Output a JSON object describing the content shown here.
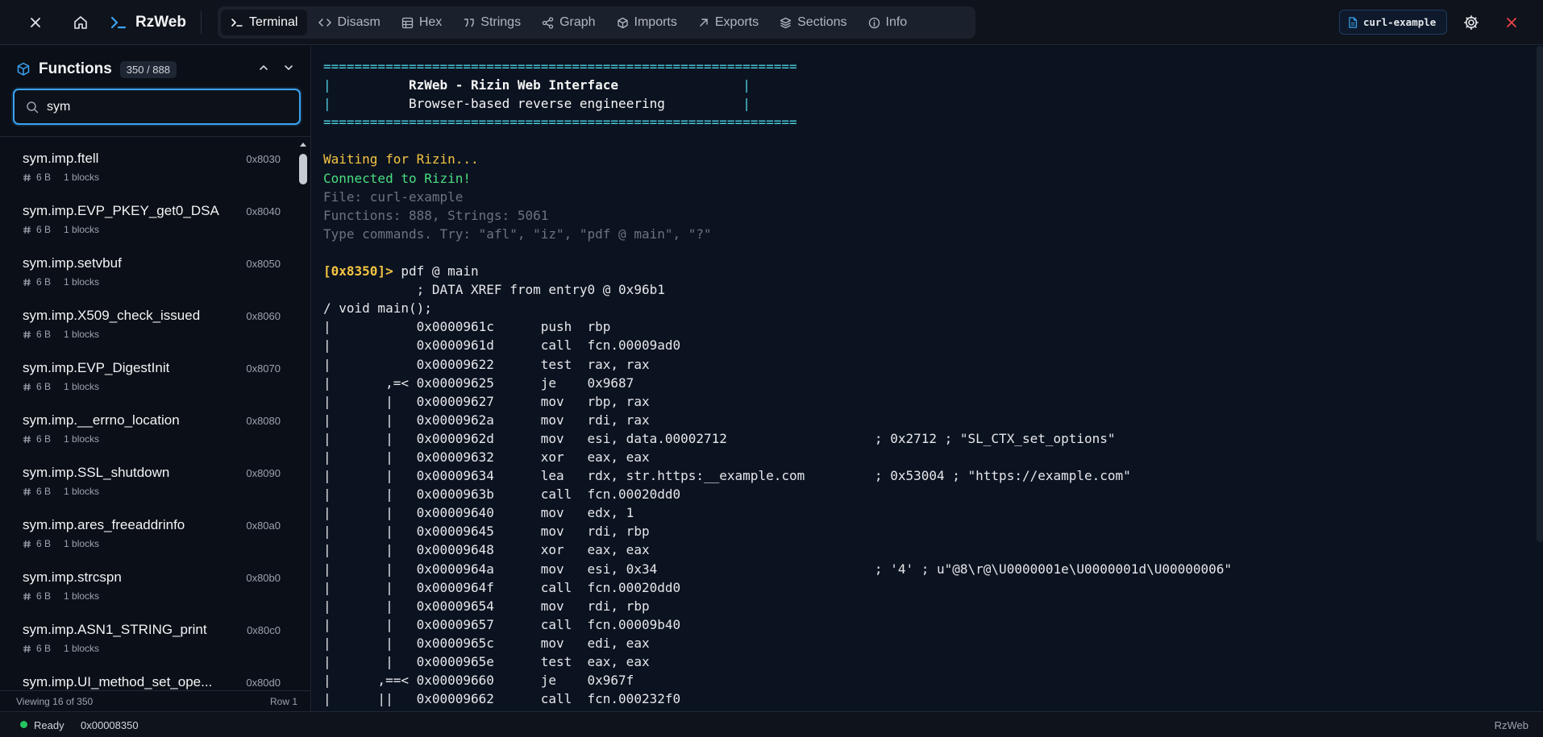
{
  "app": {
    "name": "RzWeb"
  },
  "tabs": [
    {
      "label": "Terminal",
      "icon": "terminal-icon",
      "active": true
    },
    {
      "label": "Disasm",
      "icon": "code-icon"
    },
    {
      "label": "Hex",
      "icon": "grid-icon"
    },
    {
      "label": "Strings",
      "icon": "quote-icon"
    },
    {
      "label": "Graph",
      "icon": "share-icon"
    },
    {
      "label": "Imports",
      "icon": "package-icon"
    },
    {
      "label": "Exports",
      "icon": "arrow-up-right-icon"
    },
    {
      "label": "Sections",
      "icon": "layers-icon"
    },
    {
      "label": "Info",
      "icon": "info-icon"
    }
  ],
  "file_chip": {
    "label": "curl-example"
  },
  "sidebar": {
    "title": "Functions",
    "count": "350 / 888",
    "search_value": "sym",
    "footer_left": "Viewing 16 of 350",
    "footer_right": "Row 1",
    "functions": [
      {
        "name": "sym.imp.ftell",
        "addr": "0x8030",
        "size": "6 B",
        "blocks": "1 blocks"
      },
      {
        "name": "sym.imp.EVP_PKEY_get0_DSA",
        "addr": "0x8040",
        "size": "6 B",
        "blocks": "1 blocks"
      },
      {
        "name": "sym.imp.setvbuf",
        "addr": "0x8050",
        "size": "6 B",
        "blocks": "1 blocks"
      },
      {
        "name": "sym.imp.X509_check_issued",
        "addr": "0x8060",
        "size": "6 B",
        "blocks": "1 blocks"
      },
      {
        "name": "sym.imp.EVP_DigestInit",
        "addr": "0x8070",
        "size": "6 B",
        "blocks": "1 blocks"
      },
      {
        "name": "sym.imp.__errno_location",
        "addr": "0x8080",
        "size": "6 B",
        "blocks": "1 blocks"
      },
      {
        "name": "sym.imp.SSL_shutdown",
        "addr": "0x8090",
        "size": "6 B",
        "blocks": "1 blocks"
      },
      {
        "name": "sym.imp.ares_freeaddrinfo",
        "addr": "0x80a0",
        "size": "6 B",
        "blocks": "1 blocks"
      },
      {
        "name": "sym.imp.strcspn",
        "addr": "0x80b0",
        "size": "6 B",
        "blocks": "1 blocks"
      },
      {
        "name": "sym.imp.ASN1_STRING_print",
        "addr": "0x80c0",
        "size": "6 B",
        "blocks": "1 blocks"
      },
      {
        "name": "sym.imp.UI_method_set_ope...",
        "addr": "0x80d0",
        "size": "6 B",
        "blocks": "1 blocks"
      }
    ]
  },
  "terminal": {
    "lines": [
      {
        "segments": [
          {
            "t": "=============================================================",
            "c": "c-cyan"
          }
        ]
      },
      {
        "segments": [
          {
            "t": "|",
            "c": "c-cyan"
          },
          {
            "t": "          RzWeb - Rizin Web Interface                ",
            "c": "c-white c-bold"
          },
          {
            "t": "|",
            "c": "c-cyan"
          }
        ]
      },
      {
        "segments": [
          {
            "t": "|",
            "c": "c-cyan"
          },
          {
            "t": "          Browser-based reverse engineering          ",
            "c": "c-white"
          },
          {
            "t": "|",
            "c": "c-cyan"
          }
        ]
      },
      {
        "segments": [
          {
            "t": "=============================================================",
            "c": "c-cyan"
          }
        ]
      },
      {
        "segments": [
          {
            "t": ""
          }
        ]
      },
      {
        "segments": [
          {
            "t": "Waiting for Rizin...",
            "c": "c-yellow"
          }
        ]
      },
      {
        "segments": [
          {
            "t": "Connected to Rizin!",
            "c": "c-green"
          }
        ]
      },
      {
        "segments": [
          {
            "t": "File: curl-example",
            "c": "c-gray"
          }
        ]
      },
      {
        "segments": [
          {
            "t": "Functions: 888, Strings: 5061",
            "c": "c-gray"
          }
        ]
      },
      {
        "segments": [
          {
            "t": "Type commands. Try: \"afl\", \"iz\", \"pdf @ main\", \"?\"",
            "c": "c-gray"
          }
        ]
      },
      {
        "segments": [
          {
            "t": ""
          }
        ]
      },
      {
        "segments": [
          {
            "t": "[0x8350]>",
            "c": "c-yellow c-bold"
          },
          {
            "t": " pdf @ main"
          }
        ]
      },
      {
        "segments": [
          {
            "t": "            ; DATA XREF from entry0 @ 0x96b1"
          }
        ]
      },
      {
        "segments": [
          {
            "t": "/ void main();"
          }
        ]
      },
      {
        "segments": [
          {
            "t": "|           0x0000961c      push  rbp"
          }
        ]
      },
      {
        "segments": [
          {
            "t": "|           0x0000961d      call  fcn.00009ad0"
          }
        ]
      },
      {
        "segments": [
          {
            "t": "|           0x00009622      test  rax, rax"
          }
        ]
      },
      {
        "segments": [
          {
            "t": "|       ,=< 0x00009625      je    0x9687"
          }
        ]
      },
      {
        "segments": [
          {
            "t": "|       |   0x00009627      mov   rbp, rax"
          }
        ]
      },
      {
        "segments": [
          {
            "t": "|       |   0x0000962a      mov   rdi, rax"
          }
        ]
      },
      {
        "segments": [
          {
            "t": "|       |   0x0000962d      mov   esi, data.00002712                   ; 0x2712 ; \"SL_CTX_set_options\""
          }
        ]
      },
      {
        "segments": [
          {
            "t": "|       |   0x00009632      xor   eax, eax"
          }
        ]
      },
      {
        "segments": [
          {
            "t": "|       |   0x00009634      lea   rdx, str.https:__example.com         ; 0x53004 ; \"https://example.com\""
          }
        ]
      },
      {
        "segments": [
          {
            "t": "|       |   0x0000963b      call  fcn.00020dd0"
          }
        ]
      },
      {
        "segments": [
          {
            "t": "|       |   0x00009640      mov   edx, 1"
          }
        ]
      },
      {
        "segments": [
          {
            "t": "|       |   0x00009645      mov   rdi, rbp"
          }
        ]
      },
      {
        "segments": [
          {
            "t": "|       |   0x00009648      xor   eax, eax"
          }
        ]
      },
      {
        "segments": [
          {
            "t": "|       |   0x0000964a      mov   esi, 0x34                            ; '4' ; u\"@8\\r@\\U0000001e\\U0000001d\\U00000006\""
          }
        ]
      },
      {
        "segments": [
          {
            "t": "|       |   0x0000964f      call  fcn.00020dd0"
          }
        ]
      },
      {
        "segments": [
          {
            "t": "|       |   0x00009654      mov   rdi, rbp"
          }
        ]
      },
      {
        "segments": [
          {
            "t": "|       |   0x00009657      call  fcn.00009b40"
          }
        ]
      },
      {
        "segments": [
          {
            "t": "|       |   0x0000965c      mov   edi, eax"
          }
        ]
      },
      {
        "segments": [
          {
            "t": "|       |   0x0000965e      test  eax, eax"
          }
        ]
      },
      {
        "segments": [
          {
            "t": "|      ,==< 0x00009660      je    0x967f"
          }
        ]
      },
      {
        "segments": [
          {
            "t": "|      ||   0x00009662      call  fcn.000232f0"
          }
        ]
      }
    ]
  },
  "status": {
    "state": "Ready",
    "address": "0x00008350",
    "right": "RzWeb"
  },
  "colors": {
    "accent": "#3ba3f2",
    "close_red": "#ef4444",
    "ready_green": "#22c55e"
  }
}
